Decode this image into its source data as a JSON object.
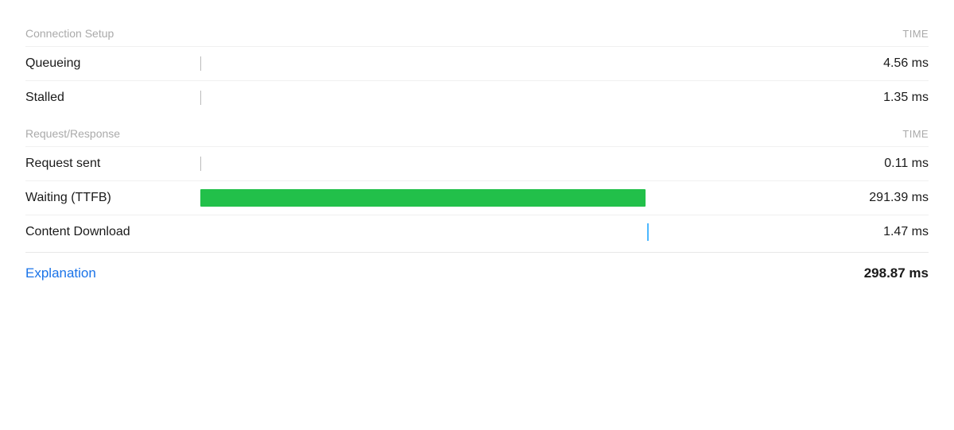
{
  "sections": {
    "connection_setup": {
      "label": "Connection Setup",
      "time_col": "TIME"
    },
    "request_response": {
      "label": "Request/Response",
      "time_col": "TIME"
    }
  },
  "rows": {
    "queueing": {
      "label": "Queueing",
      "time": "4.56 ms",
      "bar_type": "tick"
    },
    "stalled": {
      "label": "Stalled",
      "time": "1.35 ms",
      "bar_type": "tick"
    },
    "request_sent": {
      "label": "Request sent",
      "time": "0.11 ms",
      "bar_type": "tick"
    },
    "waiting_ttfb": {
      "label": "Waiting (TTFB)",
      "time": "291.39 ms",
      "bar_type": "green"
    },
    "content_download": {
      "label": "Content Download",
      "time": "1.47 ms",
      "bar_type": "blue"
    }
  },
  "footer": {
    "explanation_label": "Explanation",
    "total_time": "298.87 ms"
  }
}
